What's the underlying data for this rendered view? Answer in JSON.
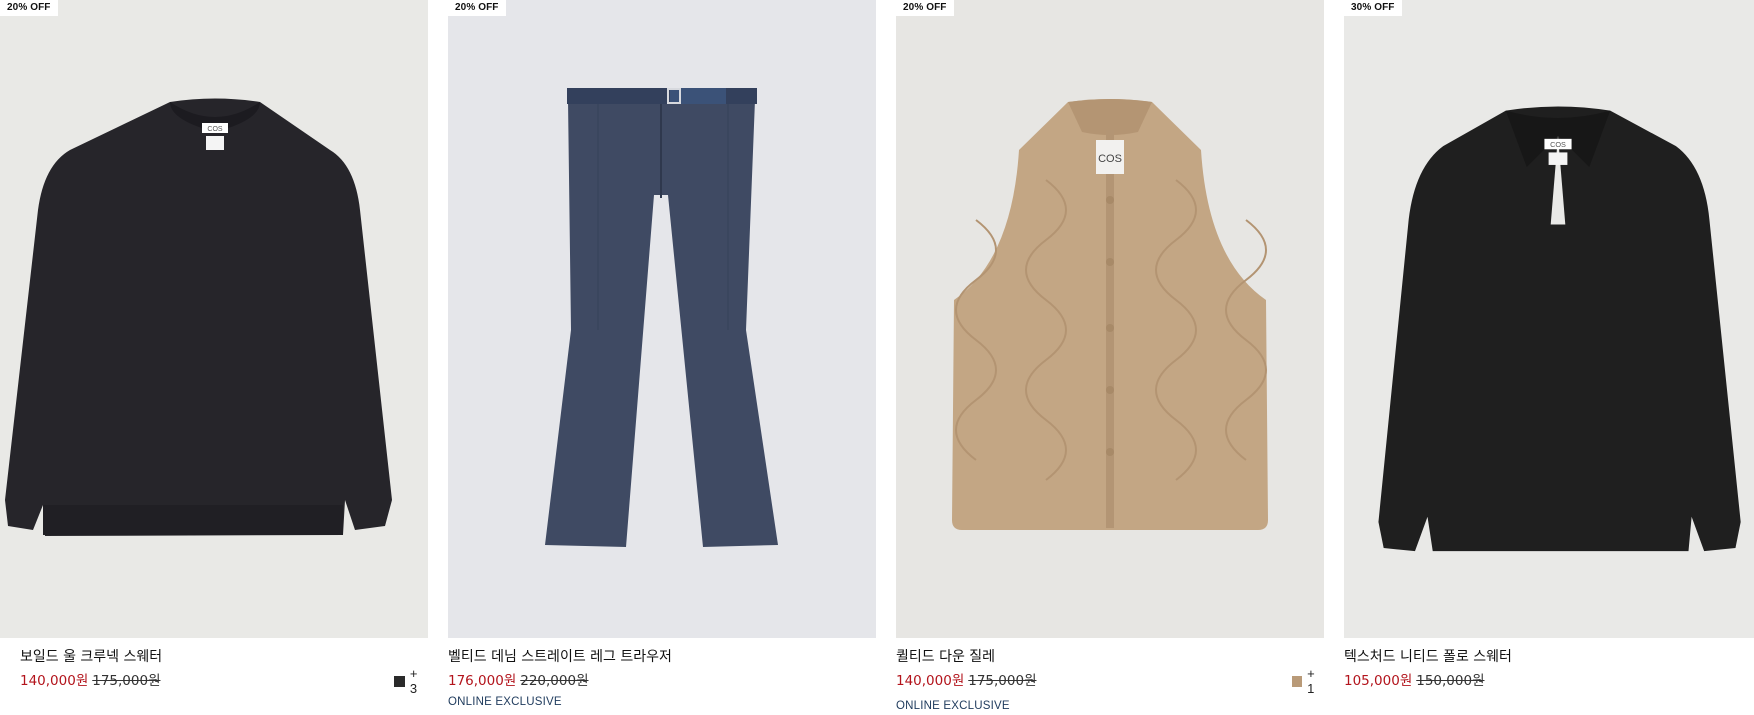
{
  "products": [
    {
      "badge": "20% OFF",
      "name": "보일드 울 크루넥 스웨터",
      "sale_price": "140,000원",
      "original_price": "175,000원",
      "swatch_color": "#2a2a2a",
      "more_colors": "+ 3",
      "image_label": "COS",
      "bg_color": "#e9e9e6",
      "garment_color": "#26252a"
    },
    {
      "badge": "20% OFF",
      "name": "벨티드 데님 스트레이트 레그 트라우저",
      "sale_price": "176,000원",
      "original_price": "220,000원",
      "exclusive": "ONLINE EXCLUSIVE",
      "bg_color": "#e5e6ea",
      "garment_color": "#3f4a63"
    },
    {
      "badge": "20% OFF",
      "name": "퀼티드 다운 질레",
      "sale_price": "140,000원",
      "original_price": "175,000원",
      "swatch_color": "#b99a78",
      "more_colors": "+ 1",
      "exclusive": "ONLINE EXCLUSIVE",
      "image_label": "COS",
      "bg_color": "#e7e6e3",
      "garment_color": "#c3a684"
    },
    {
      "badge": "30% OFF",
      "name": "텍스처드 니티드 폴로 스웨터",
      "sale_price": "105,000원",
      "original_price": "150,000원",
      "image_label": "COS",
      "bg_color": "#e9e9e7",
      "garment_color": "#1f1f1f"
    }
  ]
}
